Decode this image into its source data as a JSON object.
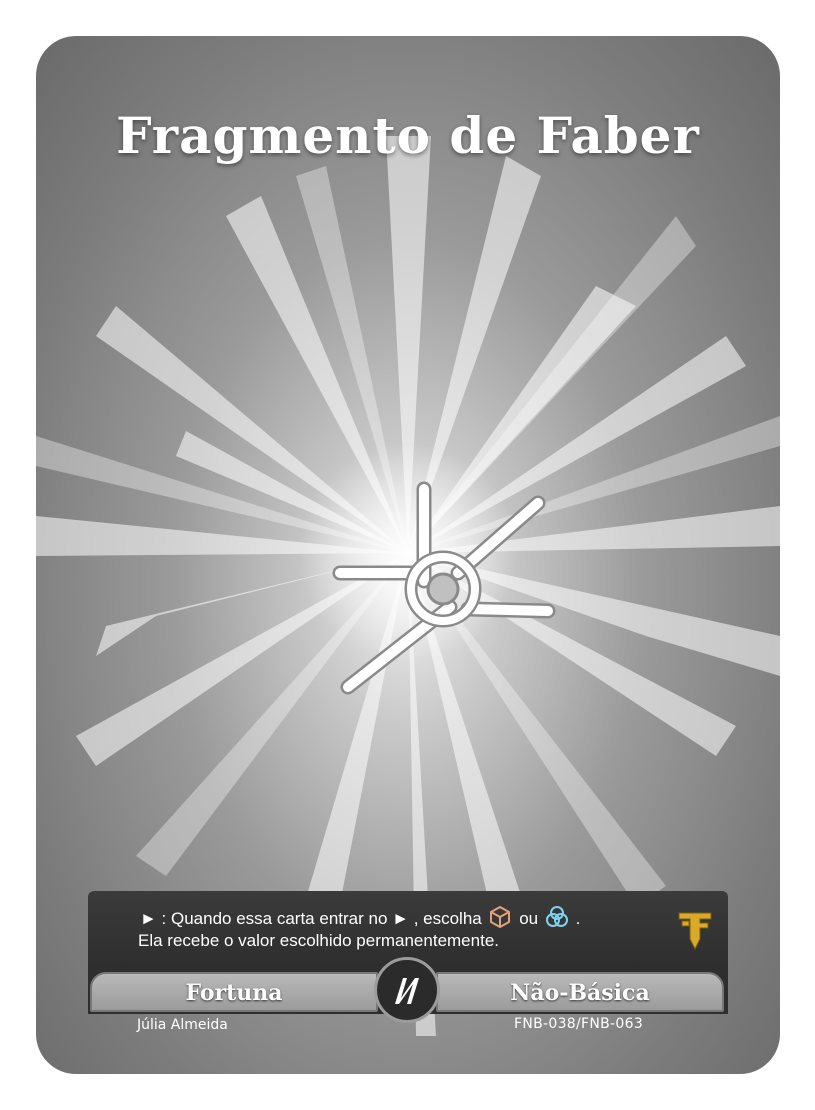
{
  "card": {
    "title": "Fragmento de Faber",
    "rules_line1_a": "► : Quando essa carta entrar no",
    "rules_line1_b": "► , escolha",
    "rules_line1_c": "ou",
    "rules_line1_d": ".",
    "rules_line2": "Ela recebe o valor escolhido permanentemente.",
    "icons": [
      "arrow-triangle-icon",
      "cube-icon",
      "three-circles-icon",
      "faber-logo-icon",
      "slash-emblem-icon",
      "compass-cross-icon"
    ],
    "type_left": "Fortuna",
    "type_right": "Não-Básica",
    "artist": "Júlia Almeida",
    "collector_code": "FNB-038/FNB-063",
    "colors": {
      "frame": "#2e2e2e",
      "plate": "#a8a8a8",
      "cube_icon": "#e5a27a",
      "circles_icon": "#7fd3f0",
      "logo_gold": "#d9a92a"
    }
  }
}
